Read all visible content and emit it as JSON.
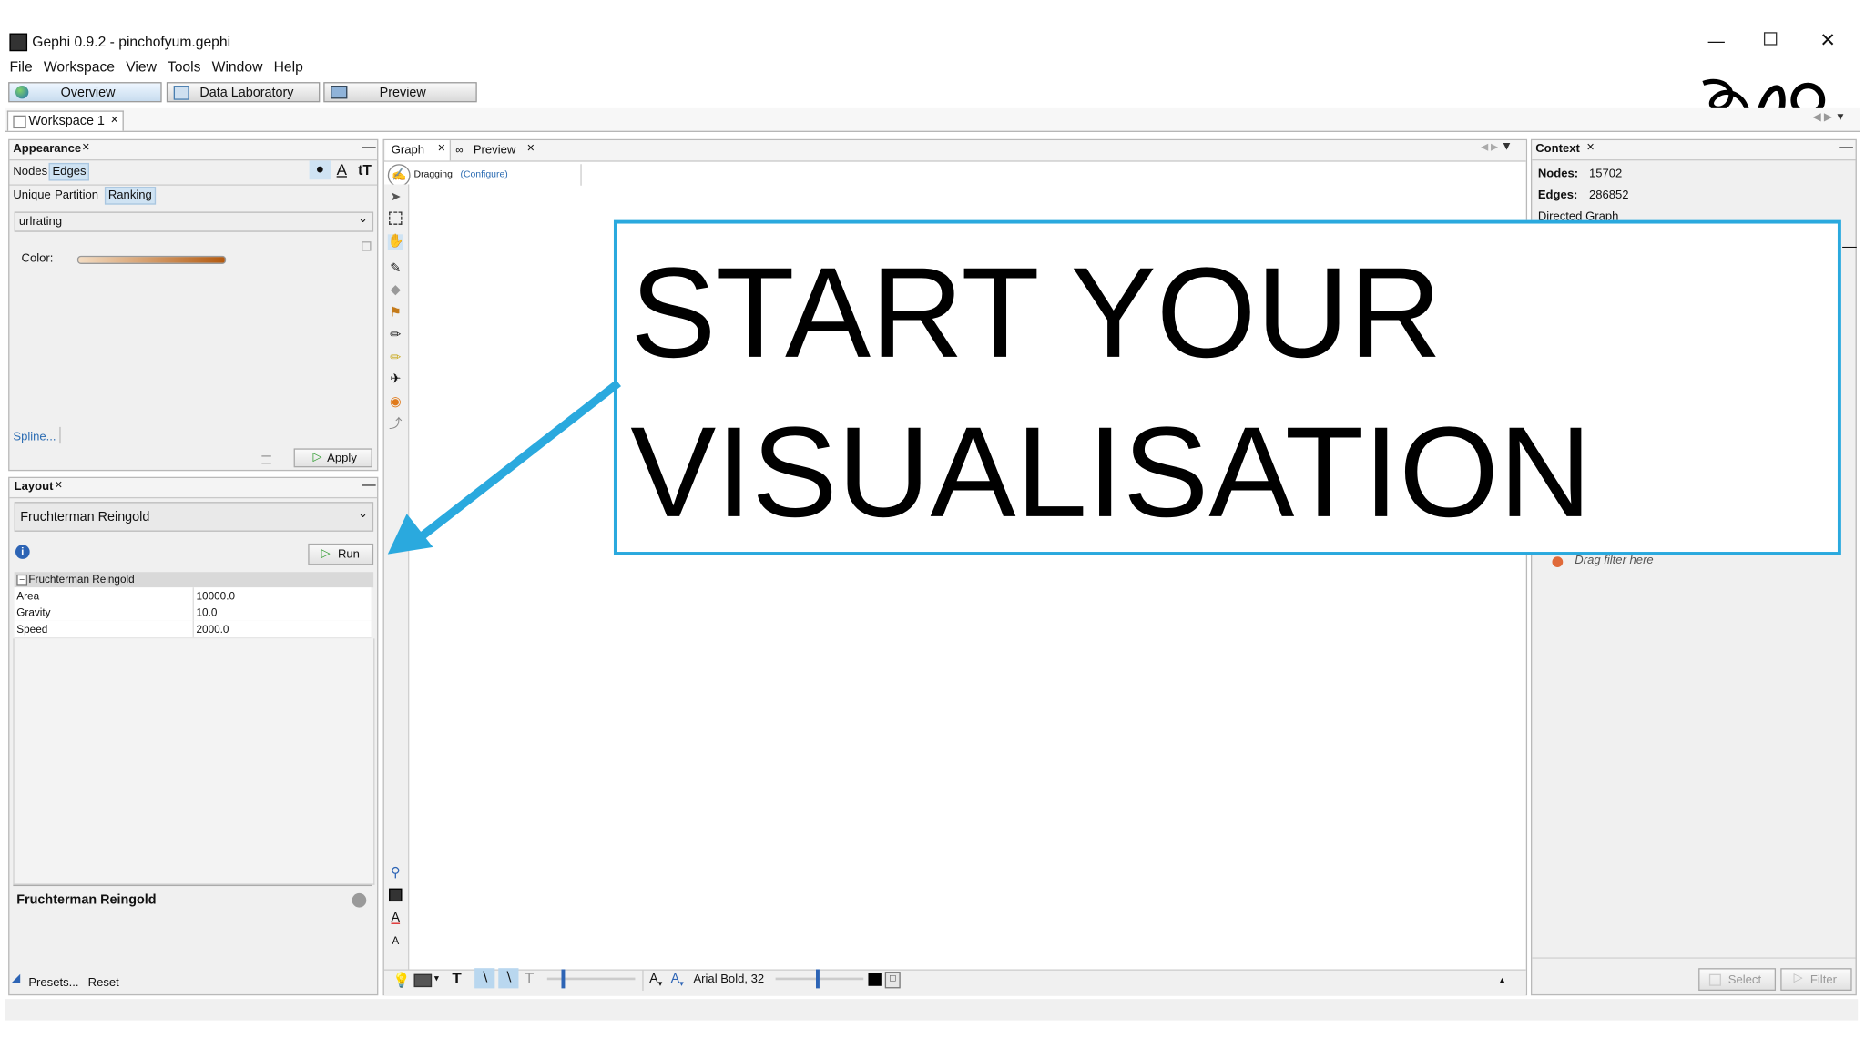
{
  "window": {
    "title": "Gephi 0.9.2 - pinchofyum.gephi"
  },
  "menu": [
    "File",
    "Workspace",
    "View",
    "Tools",
    "Window",
    "Help"
  ],
  "modes": [
    "Overview",
    "Data Laboratory",
    "Preview"
  ],
  "workspace_tab": "Workspace 1",
  "appearance": {
    "title": "Appearance",
    "element_tabs": [
      "Nodes",
      "Edges"
    ],
    "method_tabs": [
      "Unique",
      "Partition",
      "Ranking"
    ],
    "attribute": "urlrating",
    "color_label": "Color:",
    "spline_link": "Spline...",
    "apply_label": "Apply",
    "gradient": [
      "#f3dcc2",
      "#b35a10"
    ]
  },
  "layout": {
    "title": "Layout",
    "algorithm": "Fruchterman Reingold",
    "run_label": "Run",
    "group_label": "Fruchterman Reingold",
    "properties": [
      {
        "name": "Area",
        "value": "10000.0"
      },
      {
        "name": "Gravity",
        "value": "10.0"
      },
      {
        "name": "Speed",
        "value": "2000.0"
      }
    ],
    "description_title": "Fruchterman Reingold",
    "presets_label": "Presets...",
    "reset_label": "Reset"
  },
  "graph": {
    "tabs": [
      "Graph",
      "Preview"
    ],
    "mode_label": "Dragging",
    "configure_label": "(Configure)",
    "font_label": "Arial Bold, 32"
  },
  "context": {
    "title": "Context",
    "nodes_label": "Nodes:",
    "nodes_value": "15702",
    "edges_label": "Edges:",
    "edges_value": "286852",
    "graph_type": "Directed Graph"
  },
  "filters": {
    "drag_hint": "Drag filter here",
    "select_label": "Select",
    "filter_label": "Filter"
  },
  "callout": {
    "line1": "START YOUR",
    "line2": "VISUALISATION",
    "border_color": "#2aa9de",
    "arrow_color": "#2aa9de"
  },
  "colors": {
    "accent": "#2aa9de",
    "tab_selected": "#cfe3f3"
  }
}
